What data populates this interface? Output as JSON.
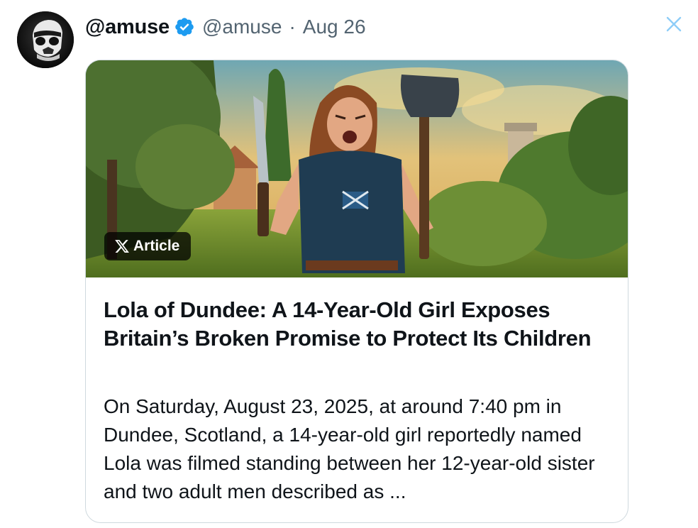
{
  "tweet": {
    "display_name": "@amuse",
    "handle": "@amuse",
    "separator": "·",
    "date": "Aug 26"
  },
  "card": {
    "badge_label": "Article",
    "title": "Lola of Dundee: A 14-Year-Old Girl Exposes Britain’s Broken Promise to Protect Its Children",
    "excerpt": "On Saturday, August 23, 2025, at around 7:40 pm in Dundee, Scotland, a 14-year-old girl reportedly named Lola was filmed standing between her 12-year-old sister and two adult men described as ..."
  },
  "icons": {
    "verified": "verified-badge-icon",
    "close": "close-icon",
    "x_logo": "x-logo-icon"
  },
  "colors": {
    "verified_blue": "#1d9bf0",
    "secondary_text": "#536471",
    "close_icon": "#8ecdf8",
    "card_border": "#cfd9de"
  }
}
